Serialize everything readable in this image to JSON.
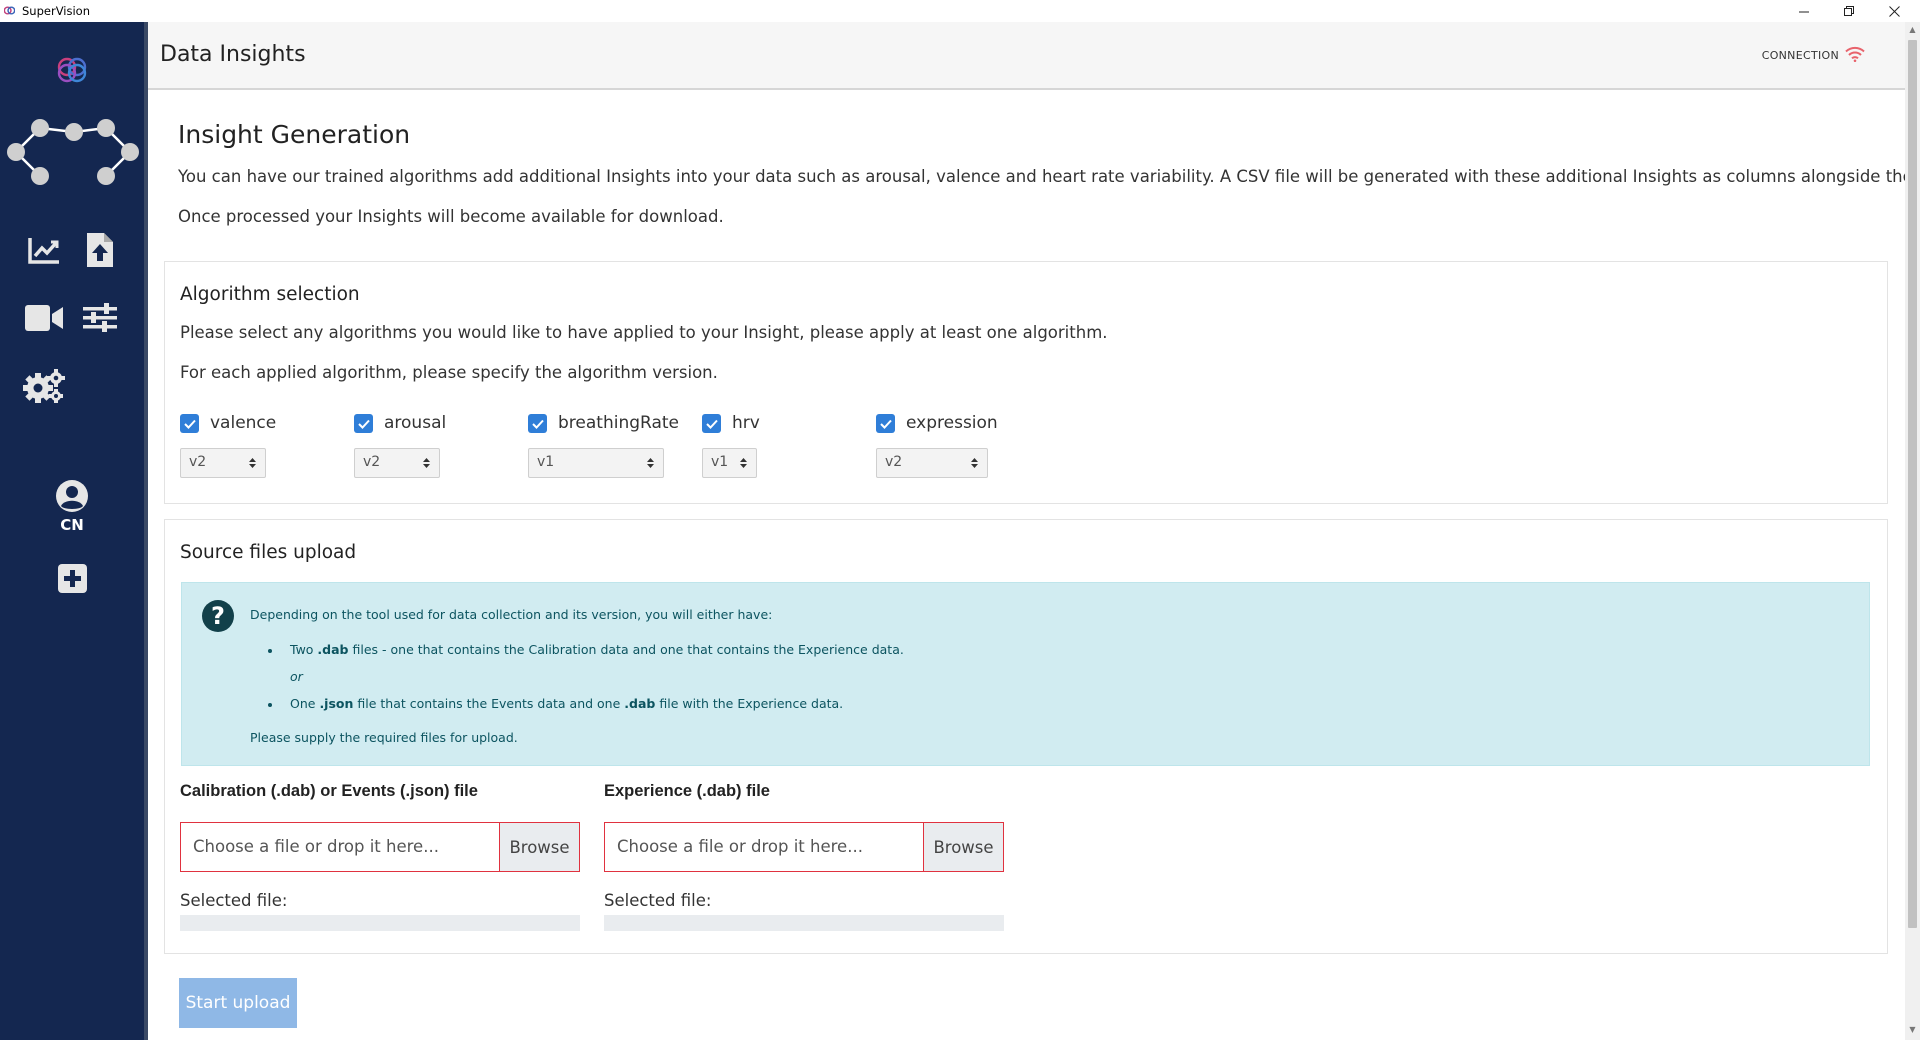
{
  "window": {
    "title": "SuperVision",
    "minimize_glyph": "—",
    "restore_glyph": "❐",
    "close_glyph": "✕"
  },
  "sidebar": {
    "items": [
      {
        "name": "brain-logo",
        "icon": "brain-icon"
      },
      {
        "name": "network-graph",
        "icon": "network-icon"
      },
      {
        "name": "analytics",
        "icon": "chart-line-icon"
      },
      {
        "name": "file-upload",
        "icon": "file-upload-icon"
      },
      {
        "name": "video",
        "icon": "video-camera-icon"
      },
      {
        "name": "settings-sliders",
        "icon": "sliders-icon"
      },
      {
        "name": "gear-settings",
        "icon": "gears-icon"
      },
      {
        "name": "user-profile",
        "icon": "user-circle-icon"
      },
      {
        "name": "add",
        "icon": "plus-square-icon"
      }
    ],
    "user_initials": "CN"
  },
  "header": {
    "title": "Data Insights",
    "connection_label": "CONNECTION",
    "connection_icon": "wifi-icon",
    "connection_color": "#e8636c"
  },
  "main": {
    "title": "Insight Generation",
    "intro": "You can have our trained algorithms add additional Insights into your data such as arousal, valence and heart rate variability. A CSV file will be generated with these additional Insights as columns alongside the raw data.",
    "intro2": "Once processed your Insights will become available for download."
  },
  "algorithm_selection": {
    "title": "Algorithm selection",
    "desc1": "Please select any algorithms you would like to have applied to your Insight, please apply at least one algorithm.",
    "desc2": "For each applied algorithm, please specify the algorithm version.",
    "algorithms": [
      {
        "label": "valence",
        "checked": true,
        "version": "v2"
      },
      {
        "label": "arousal",
        "checked": true,
        "version": "v2"
      },
      {
        "label": "breathingRate",
        "checked": true,
        "version": "v1"
      },
      {
        "label": "hrv",
        "checked": true,
        "version": "v1"
      },
      {
        "label": "expression",
        "checked": true,
        "version": "v2"
      }
    ]
  },
  "source_upload": {
    "title": "Source files upload",
    "info_icon": "question-circle-icon",
    "info": {
      "lead": "Depending on the tool used for data collection and its version, you will either have:",
      "b1_pre": "Two ",
      "b1_bold": ".dab",
      "b1_post": " files - one that contains the Calibration data and one that contains the Experience data.",
      "or": "or",
      "b2_pre": "One ",
      "b2_bold1": ".json",
      "b2_mid": " file that contains the Events data and one ",
      "b2_bold2": ".dab",
      "b2_post": " file with the Experience data.",
      "footer": "Please supply the required files for upload."
    },
    "calibration": {
      "label": "Calibration (.dab) or Events (.json) file",
      "placeholder": "Choose a file or drop it here...",
      "browse": "Browse",
      "selected_label": "Selected file:"
    },
    "experience": {
      "label": "Experience (.dab) file",
      "placeholder": "Choose a file or drop it here...",
      "browse": "Browse",
      "selected_label": "Selected file:"
    },
    "start_button": "Start upload"
  },
  "colors": {
    "sidebar_bg": "#142750",
    "checkbox": "#2f7ed8",
    "info_bg": "#d1ecf1",
    "invalid_border": "#e0323f",
    "start_button_disabled": "#8fb8e6"
  }
}
